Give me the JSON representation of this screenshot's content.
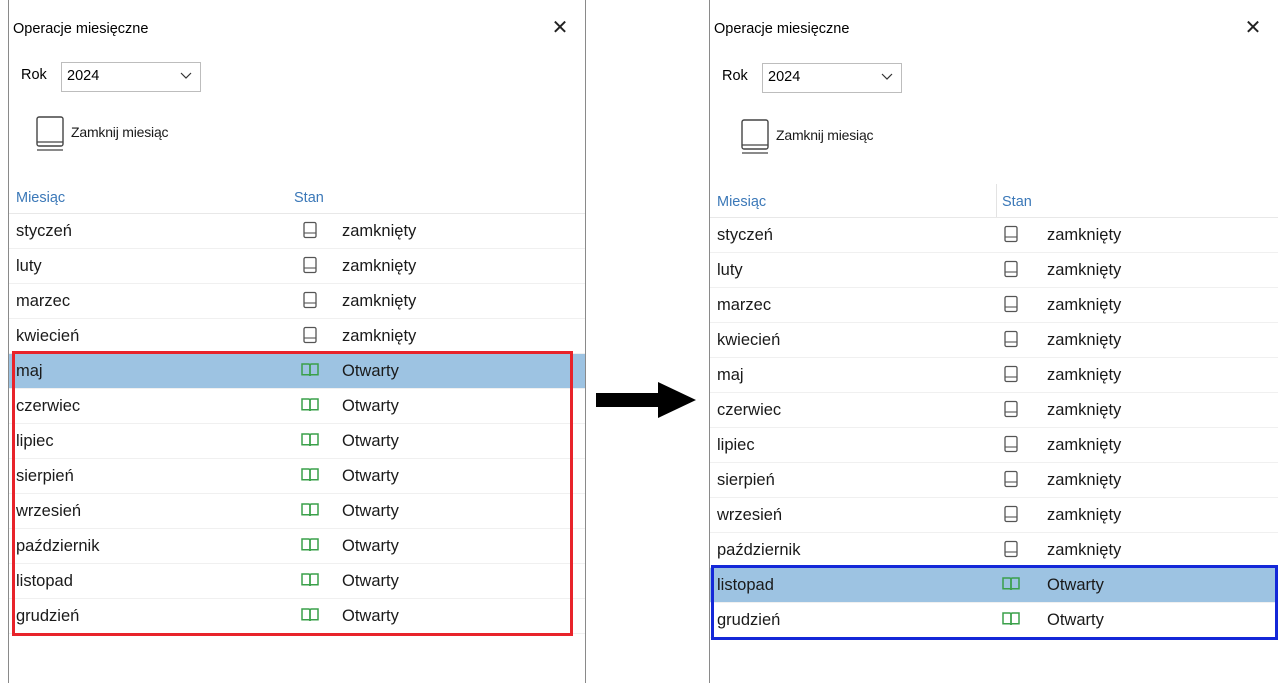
{
  "colors": {
    "header_text": "#3b78b8",
    "selected_row": "#9dc3e2",
    "open_icon": "#3aa04a",
    "closed_icon": "#555555",
    "highlight_left": "#e8232a",
    "highlight_right": "#1428d8"
  },
  "panels": [
    {
      "title": "Operacje miesięczne",
      "year_label": "Rok",
      "year_value": "2024",
      "close_month_label": "Zamknij miesiąc",
      "columns": {
        "month": "Miesiąc",
        "state": "Stan"
      },
      "selected_index": 4,
      "highlight": {
        "from": 4,
        "to": 11,
        "color": "red"
      },
      "rows": [
        {
          "month": "styczeń",
          "state": "zamknięty",
          "icon": "closed-book-icon"
        },
        {
          "month": "luty",
          "state": "zamknięty",
          "icon": "closed-book-icon"
        },
        {
          "month": "marzec",
          "state": "zamknięty",
          "icon": "closed-book-icon"
        },
        {
          "month": "kwiecień",
          "state": "zamknięty",
          "icon": "closed-book-icon"
        },
        {
          "month": "maj",
          "state": "Otwarty",
          "icon": "open-book-icon"
        },
        {
          "month": "czerwiec",
          "state": "Otwarty",
          "icon": "open-book-icon"
        },
        {
          "month": "lipiec",
          "state": "Otwarty",
          "icon": "open-book-icon"
        },
        {
          "month": "sierpień",
          "state": "Otwarty",
          "icon": "open-book-icon"
        },
        {
          "month": "wrzesień",
          "state": "Otwarty",
          "icon": "open-book-icon"
        },
        {
          "month": "październik",
          "state": "Otwarty",
          "icon": "open-book-icon"
        },
        {
          "month": "listopad",
          "state": "Otwarty",
          "icon": "open-book-icon"
        },
        {
          "month": "grudzień",
          "state": "Otwarty",
          "icon": "open-book-icon"
        }
      ]
    },
    {
      "title": "Operacje miesięczne",
      "year_label": "Rok",
      "year_value": "2024",
      "close_month_label": "Zamknij miesiąc",
      "columns": {
        "month": "Miesiąc",
        "state": "Stan"
      },
      "selected_index": 10,
      "highlight": {
        "from": 10,
        "to": 11,
        "color": "blue"
      },
      "rows": [
        {
          "month": "styczeń",
          "state": "zamknięty",
          "icon": "closed-book-icon"
        },
        {
          "month": "luty",
          "state": "zamknięty",
          "icon": "closed-book-icon"
        },
        {
          "month": "marzec",
          "state": "zamknięty",
          "icon": "closed-book-icon"
        },
        {
          "month": "kwiecień",
          "state": "zamknięty",
          "icon": "closed-book-icon"
        },
        {
          "month": "maj",
          "state": "zamknięty",
          "icon": "closed-book-icon"
        },
        {
          "month": "czerwiec",
          "state": "zamknięty",
          "icon": "closed-book-icon"
        },
        {
          "month": "lipiec",
          "state": "zamknięty",
          "icon": "closed-book-icon"
        },
        {
          "month": "sierpień",
          "state": "zamknięty",
          "icon": "closed-book-icon"
        },
        {
          "month": "wrzesień",
          "state": "zamknięty",
          "icon": "closed-book-icon"
        },
        {
          "month": "październik",
          "state": "zamknięty",
          "icon": "closed-book-icon"
        },
        {
          "month": "listopad",
          "state": "Otwarty",
          "icon": "open-book-icon"
        },
        {
          "month": "grudzień",
          "state": "Otwarty",
          "icon": "open-book-icon"
        }
      ]
    }
  ]
}
